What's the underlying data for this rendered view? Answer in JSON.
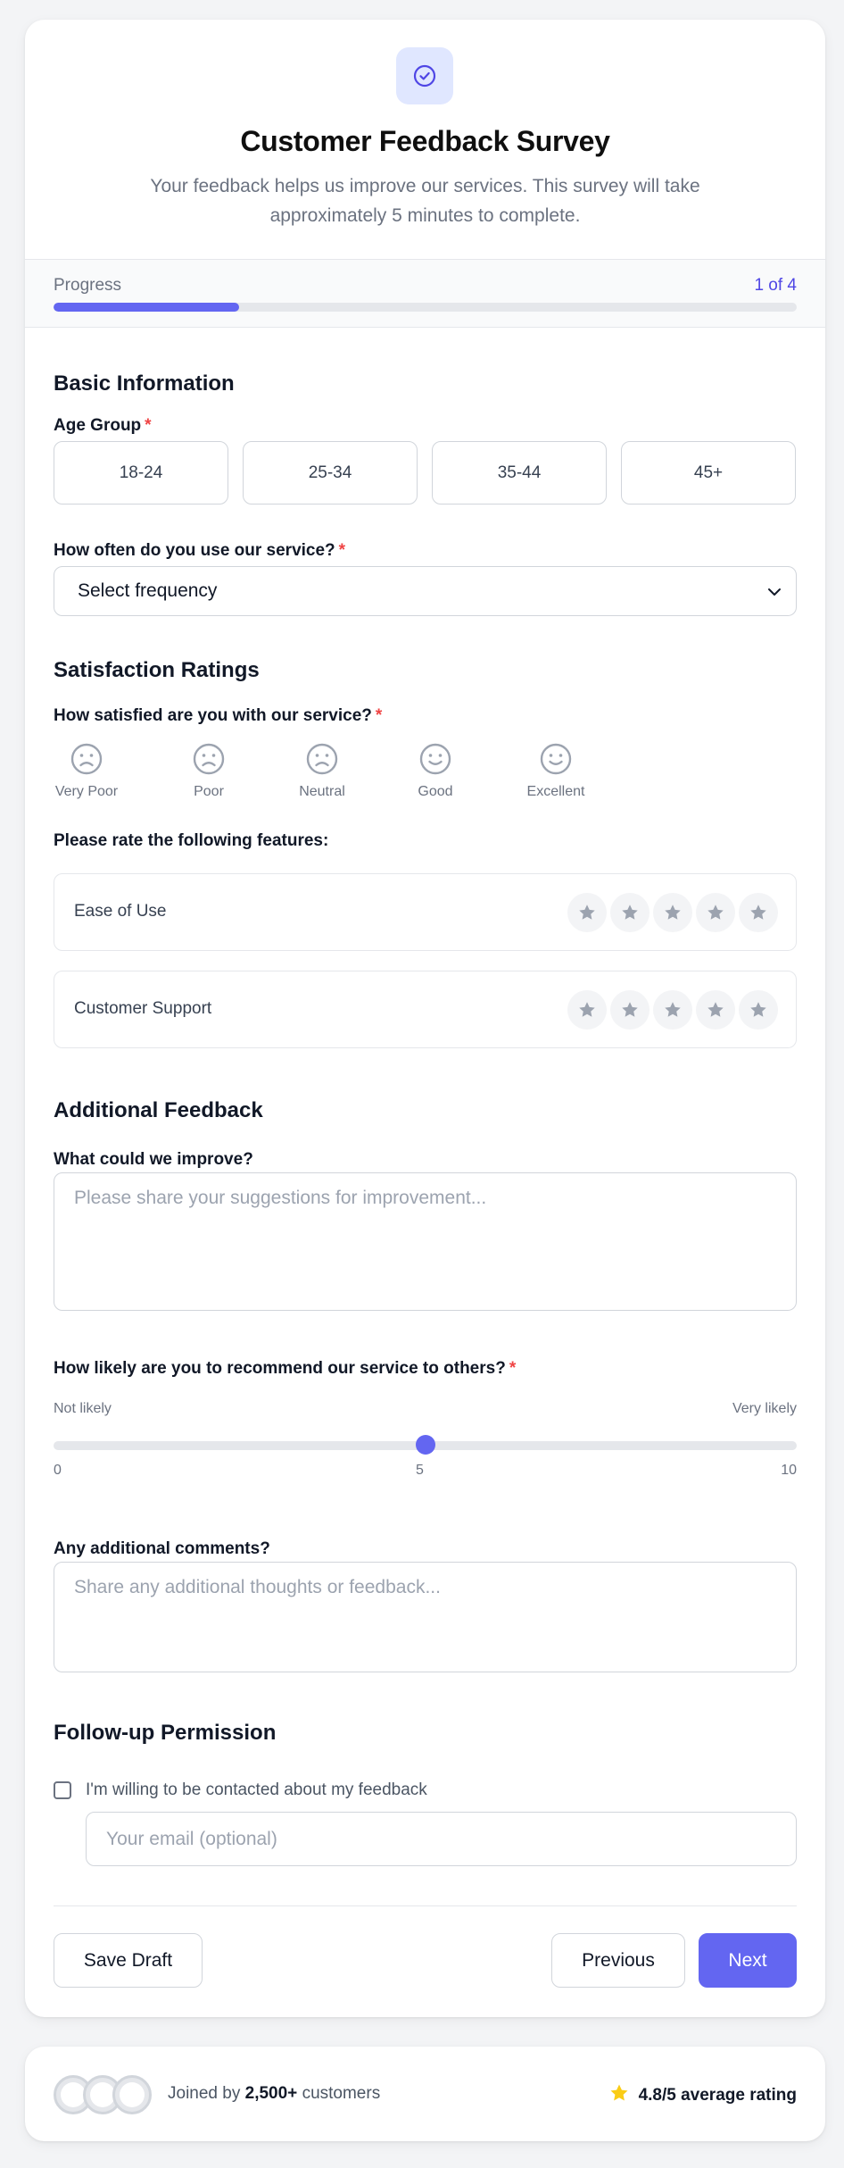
{
  "header": {
    "title": "Customer Feedback Survey",
    "subtitle": "Your feedback helps us improve our services. This survey will take approximately 5 minutes to complete."
  },
  "progress": {
    "label": "Progress",
    "step_text": "1 of 4",
    "fraction": 0.25
  },
  "colors": {
    "accent": "#6366f1",
    "required": "#ef4444",
    "star": "#facc15"
  },
  "basic_info": {
    "title": "Basic Information",
    "age_group": {
      "label": "Age Group",
      "required_mark": "*",
      "options": [
        "18-24",
        "25-34",
        "35-44",
        "45+"
      ]
    },
    "frequency": {
      "label": "How often do you use our service?",
      "required_mark": "*",
      "selected": "Select frequency"
    }
  },
  "satisfaction": {
    "title": "Satisfaction Ratings",
    "question": "How satisfied are you with our service?",
    "required_mark": "*",
    "options": [
      {
        "label": "Very Poor",
        "icon": "frown-icon"
      },
      {
        "label": "Poor",
        "icon": "frown-icon"
      },
      {
        "label": "Neutral",
        "icon": "frown-icon"
      },
      {
        "label": "Good",
        "icon": "smile-icon"
      },
      {
        "label": "Excellent",
        "icon": "smile-icon"
      }
    ],
    "features_label": "Please rate the following features:",
    "features": [
      {
        "name": "Ease of Use",
        "rating": 0,
        "max": 5
      },
      {
        "name": "Customer Support",
        "rating": 0,
        "max": 5
      }
    ]
  },
  "additional": {
    "title": "Additional Feedback",
    "improve_label": "What could we improve?",
    "improve_placeholder": "Please share your suggestions for improvement...",
    "recommend": {
      "label": "How likely are you to recommend our service to others?",
      "required_mark": "*",
      "low_label": "Not likely",
      "high_label": "Very likely",
      "min": "0",
      "mid": "5",
      "max": "10",
      "value": 5
    },
    "comments_label": "Any additional comments?",
    "comments_placeholder": "Share any additional thoughts or feedback..."
  },
  "followup": {
    "title": "Follow-up Permission",
    "checkbox_label": "I'm willing to be contacted about my feedback",
    "checked": false,
    "email_placeholder": "Your email (optional)"
  },
  "actions": {
    "save_draft": "Save Draft",
    "previous": "Previous",
    "next": "Next"
  },
  "footer": {
    "joined_prefix": "Joined by",
    "joined_count": "2,500+",
    "joined_suffix": "customers",
    "rating_text": "4.8/5 average rating"
  }
}
